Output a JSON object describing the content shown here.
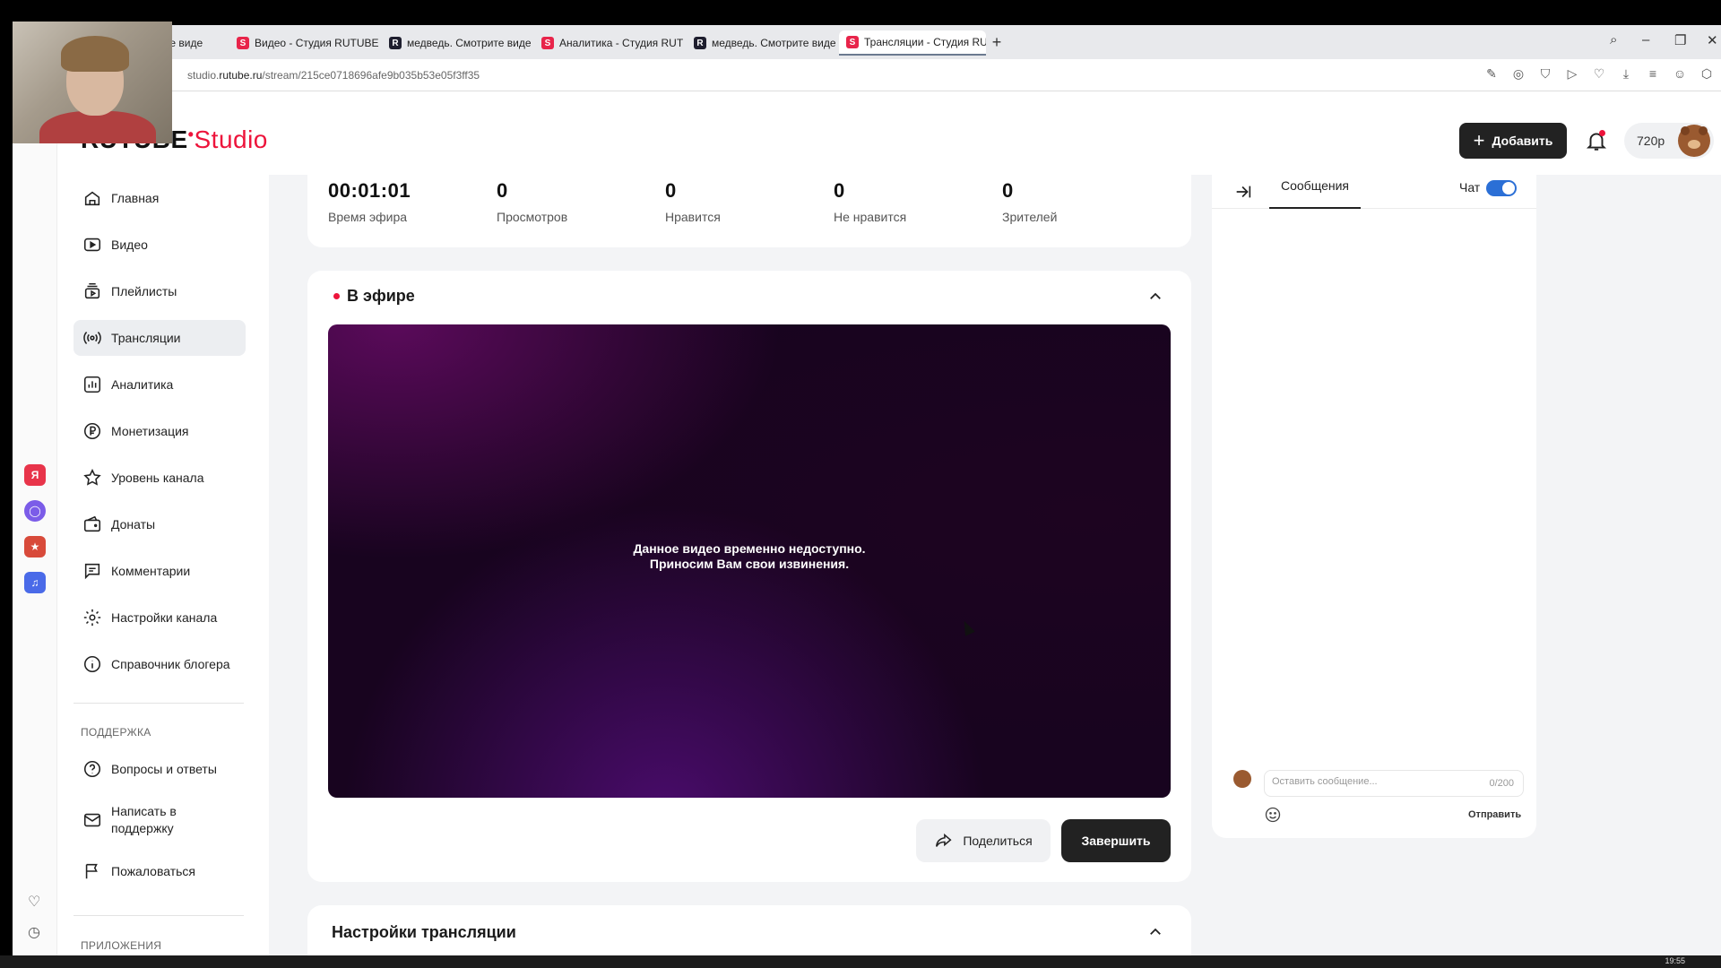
{
  "browser": {
    "tabs": [
      {
        "label": "…те виде",
        "favicon": "R"
      },
      {
        "label": "Видео - Студия RUTUBE",
        "favicon": "S"
      },
      {
        "label": "медведь. Смотрите виде",
        "favicon": "R"
      },
      {
        "label": "Аналитика - Студия RUT",
        "favicon": "S"
      },
      {
        "label": "медведь. Смотрите виде",
        "favicon": "R"
      },
      {
        "label": "Трансляции - Студия RU",
        "favicon": "S"
      }
    ],
    "new_tab": "+",
    "url_prefix": "studio.",
    "url_domain": "rutube.ru",
    "url_path": "/stream/215ce0718696afe9b035b53e05f3ff35"
  },
  "header": {
    "logo_main": "RUTUBE",
    "logo_studio": "Studio",
    "add_label": "Добавить",
    "resolution": "720р"
  },
  "sidebar": {
    "items": [
      {
        "label": "Главная",
        "icon": "home-icon"
      },
      {
        "label": "Видео",
        "icon": "video-icon"
      },
      {
        "label": "Плейлисты",
        "icon": "playlist-icon"
      },
      {
        "label": "Трансляции",
        "icon": "broadcast-icon"
      },
      {
        "label": "Аналитика",
        "icon": "analytics-icon"
      },
      {
        "label": "Монетизация",
        "icon": "ruble-icon"
      },
      {
        "label": "Уровень канала",
        "icon": "star-icon"
      },
      {
        "label": "Донаты",
        "icon": "wallet-icon"
      },
      {
        "label": "Комментарии",
        "icon": "comment-icon"
      },
      {
        "label": "Настройки канала",
        "icon": "gear-icon"
      },
      {
        "label": "Справочник блогера",
        "icon": "info-icon"
      }
    ],
    "support_heading": "ПОДДЕРЖКА",
    "support_items": [
      {
        "label": "Вопросы и ответы",
        "icon": "question-icon"
      },
      {
        "label": "Написать в поддержку",
        "icon": "mail-icon"
      },
      {
        "label": "Пожаловаться",
        "icon": "flag-icon"
      }
    ],
    "apps_heading": "ПРИЛОЖЕНИЯ"
  },
  "stats": [
    {
      "value": "00:01:01",
      "caption": "Время эфира"
    },
    {
      "value": "0",
      "caption": "Просмотров"
    },
    {
      "value": "0",
      "caption": "Нравится"
    },
    {
      "value": "0",
      "caption": "Не нравится"
    },
    {
      "value": "0",
      "caption": "Зрителей"
    }
  ],
  "live": {
    "title": "В эфире",
    "player_message_line1": "Данное видео временно недоступно.",
    "player_message_line2": "Приносим Вам свои извинения.",
    "share_label": "Поделиться",
    "finish_label": "Завершить"
  },
  "settings": {
    "title": "Настройки трансляции"
  },
  "chat": {
    "tab_messages": "Сообщения",
    "chat_toggle_label": "Чат",
    "input_placeholder": "Оставить сообщение...",
    "char_count": "0/200",
    "send_label": "Отправить"
  },
  "taskbar": {
    "clock": "19:55"
  },
  "colors": {
    "accent": "#ed143b",
    "toggle": "#2b6fd6",
    "dark_button": "#222222"
  }
}
